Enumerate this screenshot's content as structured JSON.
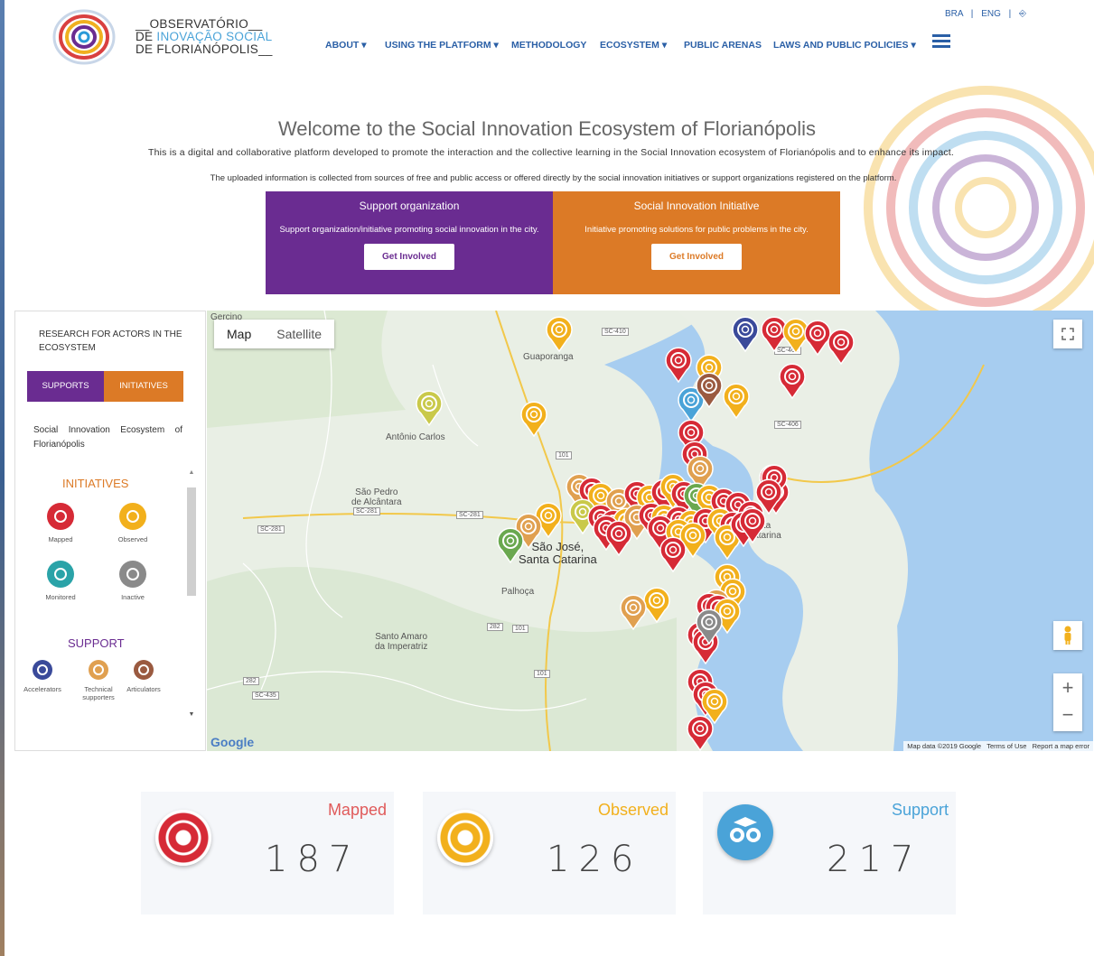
{
  "header": {
    "logo": {
      "line1": "OBSERVATÓRIO",
      "line2a": "DE ",
      "line2b": "INOVAÇÃO SOCIAL",
      "line3": "DE FLORIANÓPOLIS"
    },
    "nav": [
      {
        "label": "ABOUT ▾"
      },
      {
        "label": "USING THE PLATFORM ▾"
      },
      {
        "label": "METHODOLOGY"
      },
      {
        "label": "ECOSYSTEM ▾"
      },
      {
        "label": "PUBLIC ARENAS"
      },
      {
        "label": "LAWS AND PUBLIC POLICIES ▾"
      }
    ],
    "lang": {
      "bra": "BRA",
      "eng": "ENG",
      "sep": "|"
    }
  },
  "intro": {
    "title": "Welcome to the Social Innovation Ecosystem of Florianópolis",
    "desc1": "This is a digital and collaborative platform developed to promote the interaction and the collective learning in the Social Innovation ecosystem of Florianópolis and to enhance its impact.",
    "desc2": "The uploaded information is collected from sources of free and public access or offered directly by the social innovation initiatives or support organizations registered on the platform."
  },
  "cards": {
    "support": {
      "title": "Support organization",
      "text": "Support organization/initiative promoting social innovation in the city.",
      "button": "Get Involved",
      "color": "#6a2c91"
    },
    "initiative": {
      "title": "Social Innovation Initiative",
      "text": "Initiative promoting solutions for public problems in the city.",
      "button": "Get Involved",
      "color": "#dc7a26"
    }
  },
  "panel": {
    "title": "RESEARCH FOR ACTORS IN THE ECOSYSTEM",
    "tabs": {
      "supports": "SUPPORTS",
      "initiatives": "INITIATIVES"
    },
    "subtitle": "Social Innovation Ecosystem of Florianópolis",
    "initiatives_heading": "INITIATIVES",
    "initiatives": [
      {
        "label": "Mapped",
        "color": "#d62a36"
      },
      {
        "label": "Observed",
        "color": "#f2b01c"
      },
      {
        "label": "Monitored",
        "color": "#2aa3a8"
      },
      {
        "label": "Inactive",
        "color": "#8a8a8a"
      }
    ],
    "support_heading": "SUPPORT",
    "supports": [
      {
        "label": "Accelerators",
        "color": "#3a4a9a"
      },
      {
        "label": "Technical supporters",
        "color": "#e0a050"
      },
      {
        "label": "Articulators",
        "color": "#9a5a40"
      }
    ]
  },
  "map": {
    "toggle": {
      "map": "Map",
      "satellite": "Satellite"
    },
    "places": {
      "gercino": "Gercino",
      "guaporanga": "Guaporanga",
      "antonio_carlos": "Antônio Carlos",
      "sao_pedro": "São Pedro\nde Alcântara",
      "sao_jose": "São José,\nSanta Catarina",
      "palhoca": "Palhoça",
      "santo_amaro": "Santo Amaro\nda Imperatriz",
      "santa_catarina": "Santa\nCatarina"
    },
    "roads": [
      "SC-410",
      "SC-403",
      "SC-406",
      "101",
      "SC-281",
      "SC-281",
      "SC-281",
      "282",
      "101",
      "101",
      "282",
      "SC-435"
    ],
    "attribution": {
      "data": "Map data ©2019 Google",
      "terms": "Terms of Use",
      "report": "Report a map error"
    },
    "google": "Google",
    "zoom_in": "+",
    "zoom_out": "−"
  },
  "stats": [
    {
      "label": "Mapped",
      "value": "187",
      "color": "#e05a5a"
    },
    {
      "label": "Observed",
      "value": "126",
      "color": "#f2b01c"
    },
    {
      "label": "Support",
      "value": "217",
      "color": "#4aa3d8"
    }
  ]
}
